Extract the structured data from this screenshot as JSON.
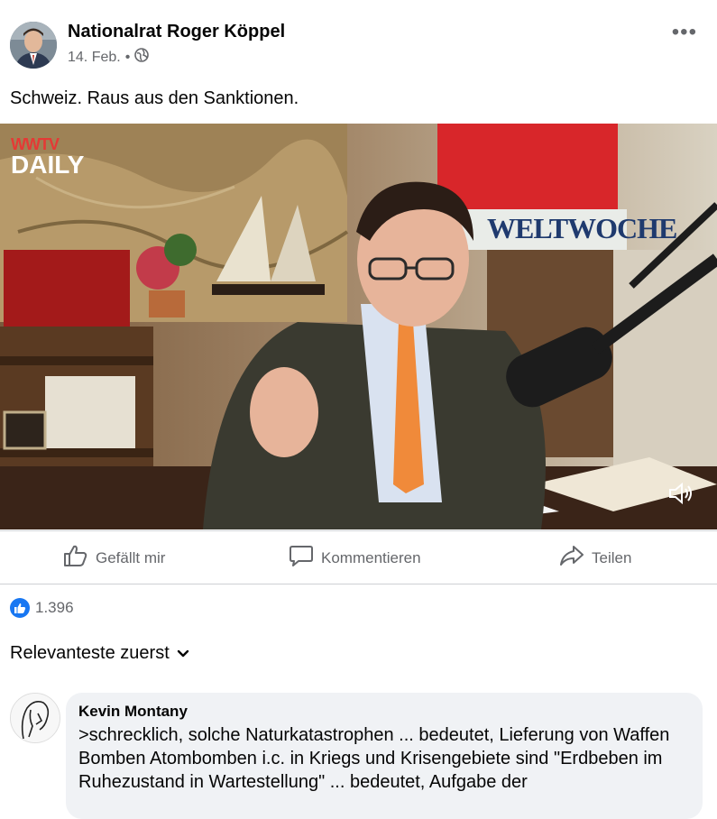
{
  "post": {
    "author": "Nationalrat Roger Köppel",
    "date": "14. Feb.",
    "separator": "•",
    "text": "Schweiz. Raus aus den Sanktionen.",
    "more_icon": "more-horizontal-icon",
    "privacy_icon": "globe-icon"
  },
  "video": {
    "brand_top": "WWTV",
    "brand_bottom": "DAILY",
    "sign_text": "WELTWOCHE",
    "mute_icon": "speaker-icon"
  },
  "actions": {
    "like": "Gefällt mir",
    "comment": "Kommentieren",
    "share": "Teilen"
  },
  "reactions": {
    "count": "1.396",
    "icon": "like-icon"
  },
  "sort": {
    "label": "Relevanteste zuerst",
    "icon": "chevron-down-icon"
  },
  "comment": {
    "name": "Kevin Montany",
    "text": ">schrecklich, solche Naturkatastrophen ... bedeutet, Lieferung von Waffen Bomben Atombomben i.c. in Kriegs und Krisengebiete sind \"Erdbeben im Ruhezustand in Wartestellung\" ... bedeutet, Aufgabe der"
  },
  "colors": {
    "accent": "#1877f2",
    "secondary_text": "#65676b",
    "bubble": "#f0f2f5"
  }
}
